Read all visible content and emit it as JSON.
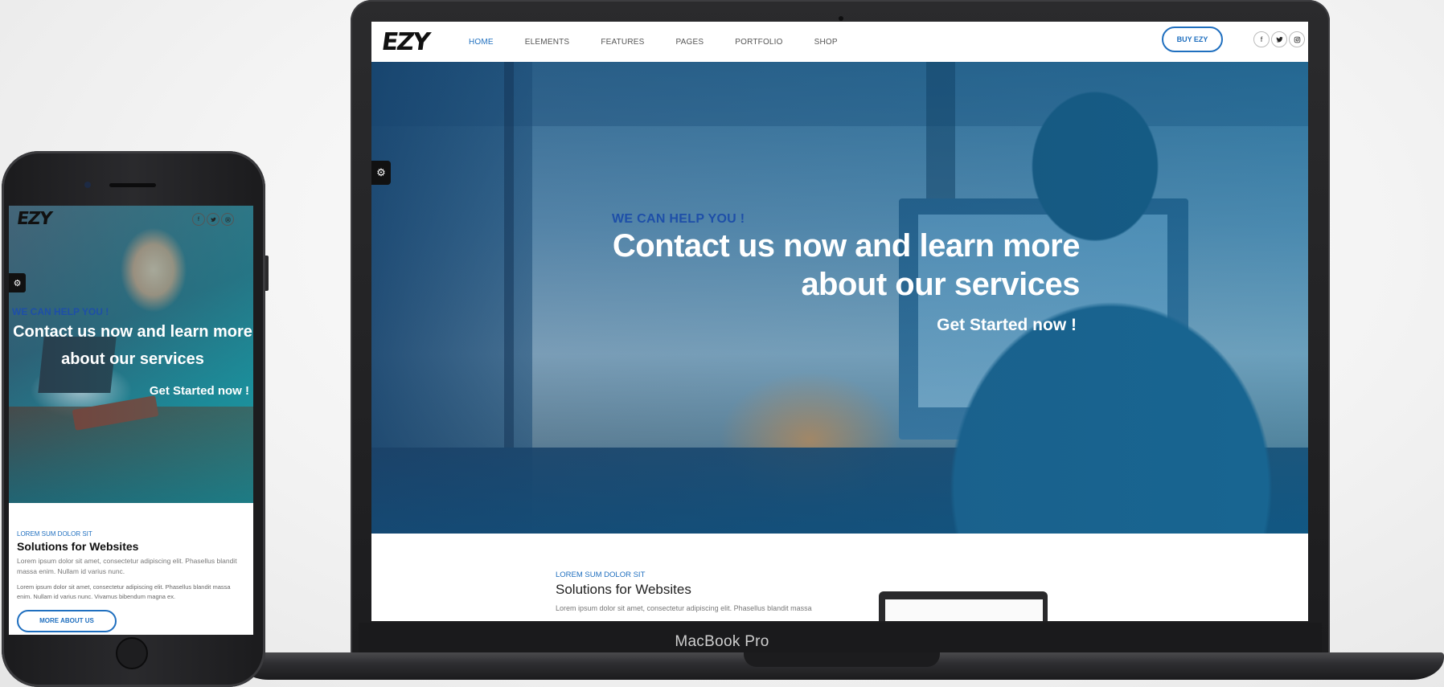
{
  "laptop": {
    "brand": "MacBook Pro",
    "site": {
      "logo": "EZY",
      "nav": [
        "HOME",
        "ELEMENTS",
        "FEATURES",
        "PAGES",
        "PORTFOLIO",
        "SHOP"
      ],
      "active_nav": "HOME",
      "buy_button": "BUY EZY",
      "socials": [
        {
          "icon": "facebook-icon",
          "glyph": "f"
        },
        {
          "icon": "twitter-icon",
          "glyph": "🐦"
        },
        {
          "icon": "instagram-icon",
          "glyph": "◎"
        }
      ],
      "settings_glyph": "⚙",
      "hero": {
        "kicker": "WE CAN HELP YOU !",
        "title_line1": "Contact us now and learn more",
        "title_line2": "about our services",
        "cta": "Get Started now !"
      },
      "content": {
        "kicker": "LOREM SUM DOLOR SIT",
        "title": "Solutions for Websites",
        "text": "Lorem ipsum dolor sit amet, consectetur adipiscing elit. Phasellus blandit massa"
      }
    }
  },
  "phone": {
    "site": {
      "logo": "EZY",
      "socials": [
        {
          "icon": "facebook-icon",
          "glyph": "f"
        },
        {
          "icon": "twitter-icon",
          "glyph": "🐦"
        },
        {
          "icon": "instagram-icon",
          "glyph": "◎"
        }
      ],
      "settings_glyph": "⚙",
      "hero": {
        "kicker": "WE CAN HELP YOU !",
        "title": "Contact us now and learn more about our services",
        "cta": "Get Started now !"
      },
      "content": {
        "kicker": "LOREM SUM DOLOR SIT",
        "title": "Solutions for Websites",
        "text1": "Lorem ipsum dolor sit amet, consectetur adipiscing elit. Phasellus blandit massa enim. Nullam id varius nunc.",
        "text2": "Lorem ipsum dolor sit amet, consectetur adipiscing elit. Phasellus blandit massa enim. Nullam id varius nunc. Vivamus bibendum magna ex.",
        "button": "MORE ABOUT US"
      }
    }
  },
  "colors": {
    "accent": "#1f6fbf",
    "kicker_blue": "#1e4fa8",
    "device_dark": "#1c1c1e"
  }
}
